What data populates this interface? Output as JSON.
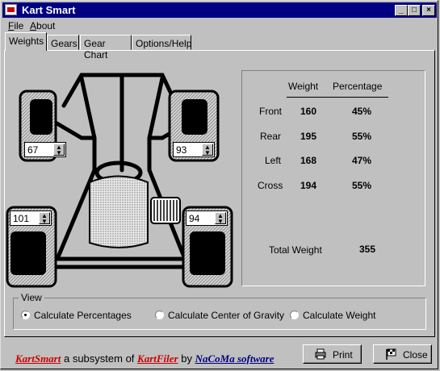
{
  "window": {
    "title": "Kart Smart"
  },
  "menu": {
    "file": "File",
    "about": "About"
  },
  "tabs": [
    "Weights",
    "Gears",
    "Gear Chart",
    "Options/Help"
  ],
  "wheels": {
    "front_left": "67",
    "front_right": "93",
    "rear_left": "101",
    "rear_right": "94"
  },
  "stats": {
    "col_weight": "Weight",
    "col_percentage": "Percentage",
    "rows": [
      {
        "label": "Front",
        "weight": "160",
        "pct": "45%"
      },
      {
        "label": "Rear",
        "weight": "195",
        "pct": "55%"
      },
      {
        "label": "Left",
        "weight": "168",
        "pct": "47%"
      },
      {
        "label": "Cross",
        "weight": "194",
        "pct": "55%"
      }
    ],
    "total_label": "Total Weight",
    "total_value": "355"
  },
  "view": {
    "label": "View",
    "options": [
      "Calculate Percentages",
      "Calculate Center of Gravity",
      "Calculate Weight"
    ],
    "selected": "Calculate Percentages"
  },
  "footer": {
    "brand": "KartSmart",
    "text1": "a subsystem of",
    "brand2": "KartFiler",
    "by": "by",
    "company": "NaCoMa software"
  },
  "buttons": {
    "print": "Print",
    "close": "Close"
  }
}
